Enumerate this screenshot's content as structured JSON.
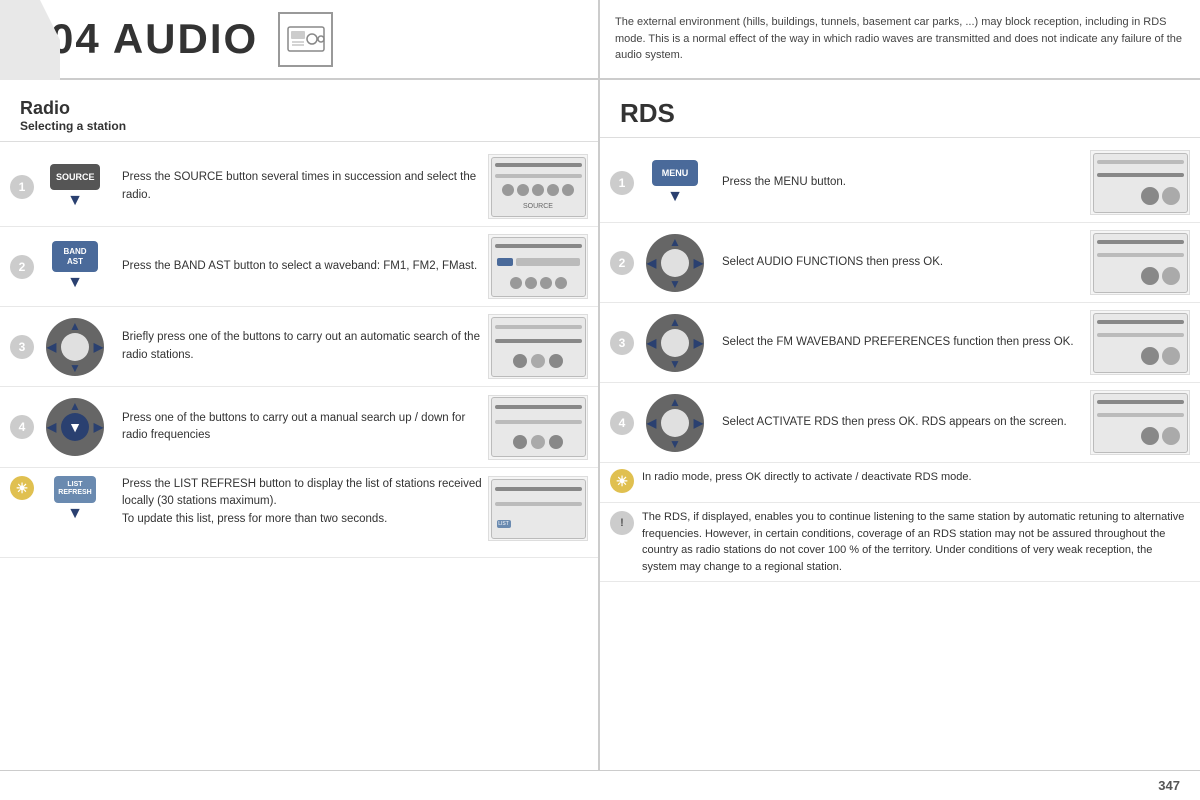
{
  "header": {
    "chapter": "04  AUDIO",
    "chapter_num": "04",
    "chapter_title": "AUDIO",
    "description": "The external environment (hills, buildings, tunnels, basement car parks, ...) may block reception, including in RDS mode. This is a normal effect of the way in which radio waves are transmitted and does not indicate any failure of the audio system."
  },
  "left_panel": {
    "heading": "Radio",
    "subheading": "Selecting a station",
    "steps": [
      {
        "num": "1",
        "icon_type": "source_button",
        "text": "Press the SOURCE button several times in succession and select the radio."
      },
      {
        "num": "2",
        "icon_type": "band_button",
        "text": "Press the BAND AST button to select a waveband: FM1, FM2, FMast."
      },
      {
        "num": "3",
        "icon_type": "nav_wheel",
        "text": "Briefly press one of the buttons to carry out an automatic search of the radio stations."
      },
      {
        "num": "4",
        "icon_type": "nav_wheel_down",
        "text": "Press one of the buttons to carry out a manual search up / down for radio frequencies"
      }
    ],
    "note": {
      "icon": "☀",
      "icon_type": "sun",
      "text": "Press the LIST REFRESH button to display the list of stations received locally (30 stations maximum).\nTo update this list, press for more than two seconds."
    }
  },
  "right_panel": {
    "heading": "RDS",
    "steps": [
      {
        "num": "1",
        "icon_type": "menu_button",
        "text": "Press the MENU button."
      },
      {
        "num": "2",
        "icon_type": "nav_wheel",
        "text": "Select AUDIO FUNCTIONS then press OK."
      },
      {
        "num": "3",
        "icon_type": "nav_wheel",
        "text": "Select the FM WAVEBAND PREFERENCES function then press OK."
      },
      {
        "num": "4",
        "icon_type": "nav_wheel",
        "text": "Select ACTIVATE RDS then press OK. RDS appears on the screen."
      }
    ],
    "notes": [
      {
        "icon": "☀",
        "icon_type": "sun",
        "text": "In radio mode, press OK directly to activate / deactivate RDS mode."
      },
      {
        "icon": "!",
        "icon_type": "exclamation",
        "text": "The RDS, if displayed, enables you to continue listening to the same station by automatic retuning to alternative frequencies. However, in certain conditions, coverage of an RDS station may not be assured throughout the country as radio stations do not cover 100 % of the territory. Under conditions of very weak reception, the system may change to a regional station."
      }
    ]
  },
  "footer": {
    "page_number": "347"
  }
}
